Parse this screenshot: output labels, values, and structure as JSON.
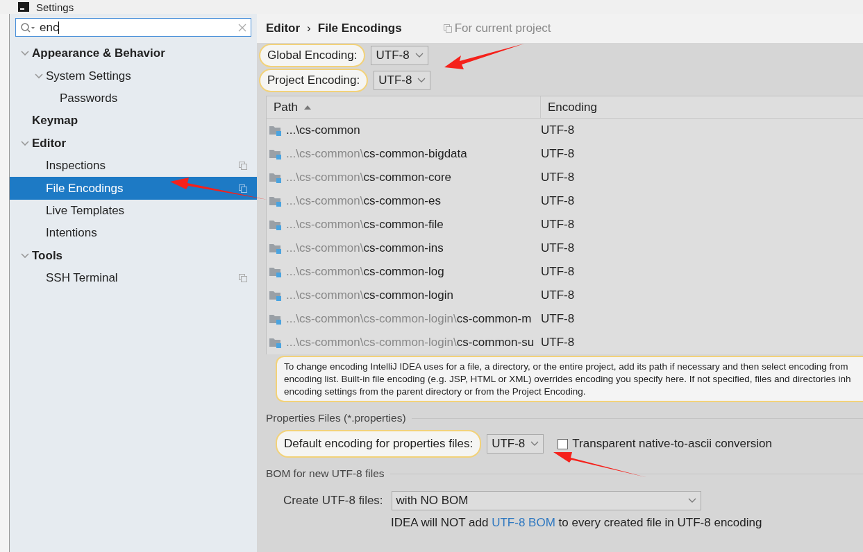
{
  "window": {
    "title": "Settings"
  },
  "search": {
    "value": "enc"
  },
  "sidebar": {
    "items": [
      {
        "label": "Appearance & Behavior",
        "expanded": true,
        "selected": false,
        "children": [
          {
            "label": "System Settings",
            "expanded": true,
            "selected": false,
            "children": [
              {
                "label": "Passwords",
                "selected": false,
                "project_scope": false
              }
            ],
            "project_scope": false
          }
        ],
        "project_scope": false
      },
      {
        "label": "Keymap",
        "selected": false,
        "project_scope": false
      },
      {
        "label": "Editor",
        "expanded": true,
        "selected": false,
        "project_scope": false,
        "children": [
          {
            "label": "Inspections",
            "selected": false,
            "project_scope": true
          },
          {
            "label": "File Encodings",
            "selected": true,
            "project_scope": true
          },
          {
            "label": "Live Templates",
            "selected": false,
            "project_scope": false
          },
          {
            "label": "Intentions",
            "selected": false,
            "project_scope": false
          }
        ]
      },
      {
        "label": "Tools",
        "expanded": true,
        "selected": false,
        "project_scope": false,
        "children": [
          {
            "label": "SSH Terminal",
            "selected": false,
            "project_scope": true
          }
        ]
      }
    ]
  },
  "breadcrumb": {
    "items": [
      "Editor",
      "File Encodings"
    ],
    "separator": "›",
    "scope_note": "For current project"
  },
  "encodings": [
    {
      "label": "Global Encoding:",
      "value": "UTF-8",
      "highlighted": true
    },
    {
      "label": "Project Encoding:",
      "value": "UTF-8",
      "highlighted": true
    }
  ],
  "table": {
    "columns": [
      {
        "label": "Path",
        "sorted": true
      },
      {
        "label": "Encoding",
        "sorted": false
      }
    ],
    "rows": [
      {
        "path": [
          {
            "text": "...\\cs-common",
            "dim": false
          }
        ],
        "encoding": "UTF-8"
      },
      {
        "path": [
          {
            "text": "...\\cs-common\\",
            "dim": true
          },
          {
            "text": "cs-common-bigdata",
            "dim": false
          }
        ],
        "encoding": "UTF-8"
      },
      {
        "path": [
          {
            "text": "...\\cs-common\\",
            "dim": true
          },
          {
            "text": "cs-common-core",
            "dim": false
          }
        ],
        "encoding": "UTF-8"
      },
      {
        "path": [
          {
            "text": "...\\cs-common\\",
            "dim": true
          },
          {
            "text": "cs-common-es",
            "dim": false
          }
        ],
        "encoding": "UTF-8"
      },
      {
        "path": [
          {
            "text": "...\\cs-common\\",
            "dim": true
          },
          {
            "text": "cs-common-file",
            "dim": false
          }
        ],
        "encoding": "UTF-8"
      },
      {
        "path": [
          {
            "text": "...\\cs-common\\",
            "dim": true
          },
          {
            "text": "cs-common-ins",
            "dim": false
          }
        ],
        "encoding": "UTF-8"
      },
      {
        "path": [
          {
            "text": "...\\cs-common\\",
            "dim": true
          },
          {
            "text": "cs-common-log",
            "dim": false
          }
        ],
        "encoding": "UTF-8"
      },
      {
        "path": [
          {
            "text": "...\\cs-common\\",
            "dim": true
          },
          {
            "text": "cs-common-login",
            "dim": false
          }
        ],
        "encoding": "UTF-8"
      },
      {
        "path": [
          {
            "text": "...\\cs-common\\cs-common-login\\",
            "dim": true
          },
          {
            "text": "cs-common-m",
            "dim": false
          }
        ],
        "encoding": "UTF-8"
      },
      {
        "path": [
          {
            "text": "...\\cs-common\\cs-common-login\\",
            "dim": true
          },
          {
            "text": "cs-common-su",
            "dim": false
          }
        ],
        "encoding": "UTF-8"
      }
    ]
  },
  "hint": {
    "lines": [
      "To change encoding IntelliJ IDEA uses for a file, a directory, or the entire project, add its path if necessary and then select encoding from",
      "encoding list. Built-in file encoding (e.g. JSP, HTML or XML) overrides encoding you specify here. If not specified, files and directories inh",
      "encoding settings from the parent directory or from the Project Encoding."
    ]
  },
  "properties": {
    "section": "Properties Files (*.properties)",
    "label": "Default encoding for properties files:",
    "highlighted": true,
    "value": "UTF-8",
    "checkbox": {
      "label": "Transparent native-to-ascii conversion",
      "checked": false
    }
  },
  "bom": {
    "section": "BOM for new UTF-8 files",
    "label": "Create UTF-8 files:",
    "value": "with NO BOM",
    "note_before": "IDEA will NOT add ",
    "note_link": "UTF-8 BOM",
    "note_after": " to every created file in UTF-8 encoding"
  }
}
